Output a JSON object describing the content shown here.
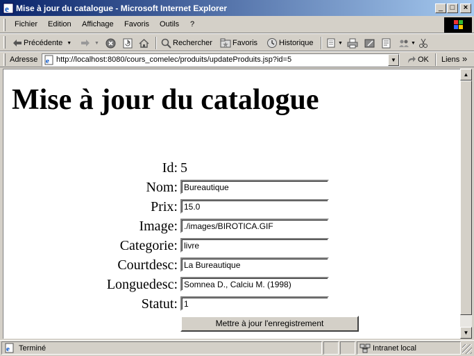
{
  "window": {
    "title": "Mise à jour du catalogue - Microsoft Internet Explorer",
    "minimize_glyph": "_",
    "maximize_glyph": "□",
    "close_glyph": "×"
  },
  "menu": {
    "items": [
      "Fichier",
      "Edition",
      "Affichage",
      "Favoris",
      "Outils",
      "?"
    ]
  },
  "toolbar": {
    "back_label": "Précédente",
    "search_label": "Rechercher",
    "favorites_label": "Favoris",
    "history_label": "Historique"
  },
  "address": {
    "label": "Adresse",
    "url": "http://localhost:8080/cours_comelec/produits/updateProduits.jsp?id=5",
    "go_label": "OK",
    "links_label": "Liens",
    "chevron": "»"
  },
  "page": {
    "heading": "Mise à jour du catalogue",
    "form": {
      "id_label": "Id:",
      "id_value": "5",
      "fields": [
        {
          "label": "Nom:",
          "value": "Bureautique"
        },
        {
          "label": "Prix:",
          "value": "15.0"
        },
        {
          "label": "Image:",
          "value": "./images/BIROTICA.GIF"
        },
        {
          "label": "Categorie:",
          "value": "livre"
        },
        {
          "label": "Courtdesc:",
          "value": "La Bureautique"
        },
        {
          "label": "Longuedesc:",
          "value": "Somnea D., Calciu M. (1998)"
        },
        {
          "label": "Statut:",
          "value": "1"
        }
      ],
      "submit_label": "Mettre à jour l'enregistrement"
    }
  },
  "status": {
    "text": "Terminé",
    "zone": "Intranet local"
  },
  "colors": {
    "title_gradient_start": "#0a246a",
    "title_gradient_end": "#a6caf0",
    "chrome": "#d4d0c8",
    "content_bg": "#ffffff"
  }
}
